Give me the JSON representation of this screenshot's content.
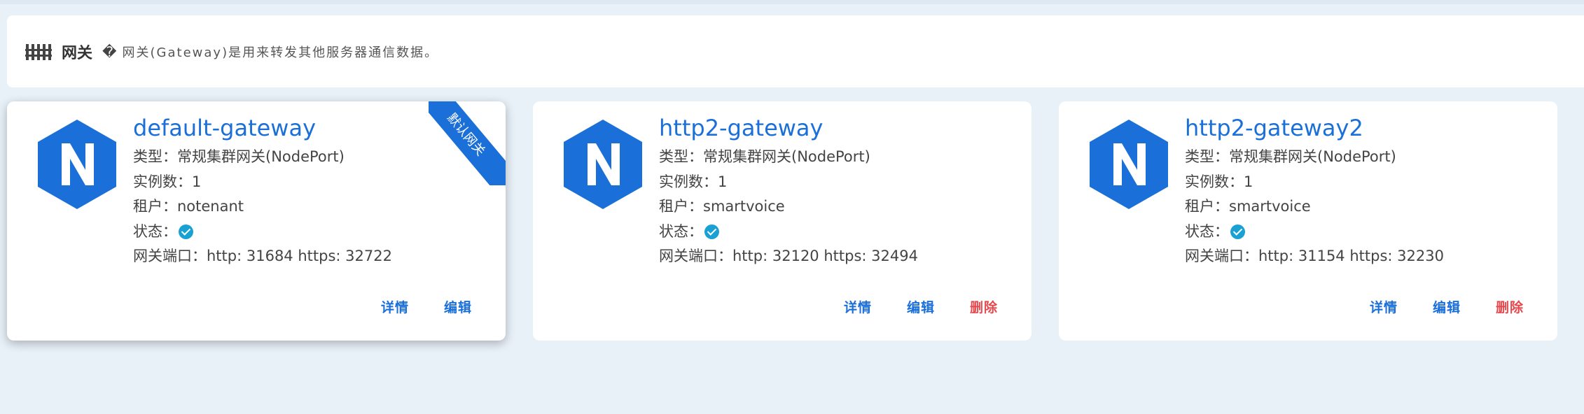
{
  "header": {
    "title": "网关",
    "help_glyph": "�",
    "description": "网关(Gateway)是用来转发其他服务器通信数据。"
  },
  "labels": {
    "type": "类型：",
    "instances": "实例数：",
    "tenant": "租户：",
    "status": "状态：",
    "ports": "网关端口："
  },
  "cards": [
    {
      "name": "default-gateway",
      "ribbon": "默认网关",
      "type": "常规集群网关(NodePort)",
      "instances": "1",
      "tenant": "notenant",
      "status": "running",
      "ports": "http: 31684 https: 32722",
      "actions": {
        "detail": "详情",
        "edit": "编辑"
      }
    },
    {
      "name": "http2-gateway",
      "type": "常规集群网关(NodePort)",
      "instances": "1",
      "tenant": "smartvoice",
      "status": "running",
      "ports": "http: 32120 https: 32494",
      "actions": {
        "detail": "详情",
        "edit": "编辑",
        "delete": "删除"
      }
    },
    {
      "name": "http2-gateway2",
      "type": "常规集群网关(NodePort)",
      "instances": "1",
      "tenant": "smartvoice",
      "status": "running",
      "ports": "http: 31154 https: 32230",
      "actions": {
        "detail": "详情",
        "edit": "编辑",
        "delete": "删除"
      }
    }
  ],
  "icons": {
    "logo": "nginx-hexagon-icon",
    "header": "fence-icon",
    "status": "check-circle-icon"
  },
  "colors": {
    "primary": "#1a6fd8",
    "danger": "#e5484d",
    "status_ok": "#1aa1d4"
  }
}
